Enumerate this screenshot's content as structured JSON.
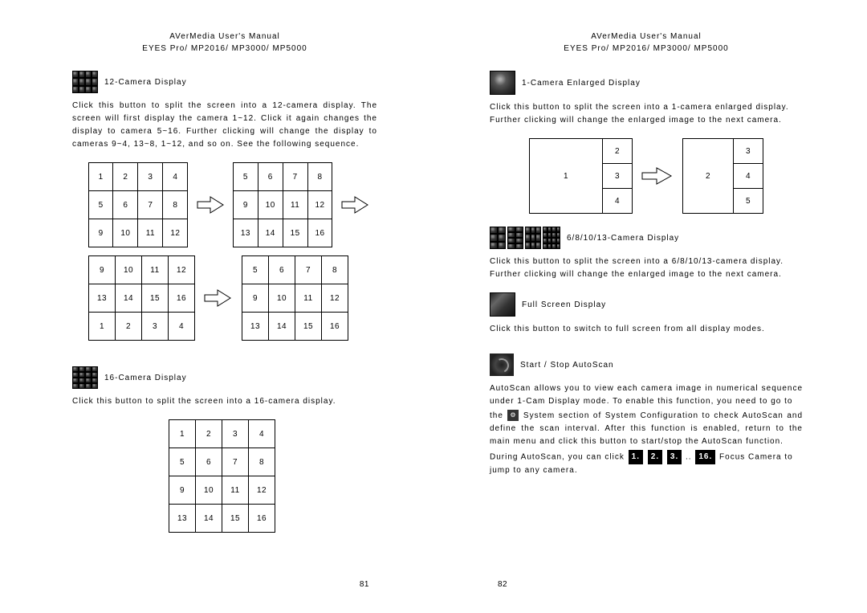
{
  "header": "AVerMedia User's Manual",
  "subheader": "EYES Pro/ MP2016/ MP3000/ MP5000",
  "left": {
    "sec12": {
      "title": "12-Camera Display",
      "para": "Click this button to split the screen into a 12-camera display.  The screen will first display the camera 1~12.  Click it again changes the display to camera 5~16.  Further clicking will change the display to cameras 9~4, 13~8, 1~12, and so on.  See the following sequence."
    },
    "grid1": [
      [
        "1",
        "2",
        "3",
        "4"
      ],
      [
        "5",
        "6",
        "7",
        "8"
      ],
      [
        "9",
        "10",
        "11",
        "12"
      ]
    ],
    "grid2": [
      [
        "5",
        "6",
        "7",
        "8"
      ],
      [
        "9",
        "10",
        "11",
        "12"
      ],
      [
        "13",
        "14",
        "15",
        "16"
      ]
    ],
    "grid3": [
      [
        "9",
        "10",
        "11",
        "12"
      ],
      [
        "13",
        "14",
        "15",
        "16"
      ],
      [
        "1",
        "2",
        "3",
        "4"
      ]
    ],
    "grid4": [
      [
        "5",
        "6",
        "7",
        "8"
      ],
      [
        "9",
        "10",
        "11",
        "12"
      ],
      [
        "13",
        "14",
        "15",
        "16"
      ]
    ],
    "sec16": {
      "title": "16-Camera Display",
      "para": "Click this button to split the screen into a 16-camera display."
    },
    "grid16": [
      [
        "1",
        "2",
        "3",
        "4"
      ],
      [
        "5",
        "6",
        "7",
        "8"
      ],
      [
        "9",
        "10",
        "11",
        "12"
      ],
      [
        "13",
        "14",
        "15",
        "16"
      ]
    ],
    "pagenum": "81"
  },
  "right": {
    "sec1": {
      "title": "1-Camera Enlarged Display",
      "para": "Click this button to split the screen into a 1-camera enlarged display.  Further clicking will change the enlarged image to the next camera."
    },
    "layoutA": {
      "big": "1",
      "side": [
        "2",
        "3",
        "4"
      ]
    },
    "layoutB": {
      "big": "2",
      "side": [
        "3",
        "4",
        "5"
      ]
    },
    "sec6": {
      "title": "6/8/10/13-Camera Display",
      "para": "Click this button to split the screen into a 6/8/10/13-camera display.  Further clicking will change the enlarged image to the next camera."
    },
    "secFull": {
      "title": "Full Screen Display",
      "para": "Click this button to switch to full screen from all display modes."
    },
    "secAuto": {
      "title": "Start / Stop AutoScan",
      "p1": "AutoScan allows you to view each camera image in numerical sequence under 1-Cam Display mode.  To enable this function, you need to go to",
      "p2a": "the",
      "p2b": "System section of System Configuration to check AutoScan and define the scan interval.  After this function is enabled, return to the main menu and click this button to start/stop the AutoScan function.",
      "p3a": "During AutoScan, you can click",
      "btns": [
        "1.",
        "2.",
        "3."
      ],
      "ellipsis": "..",
      "btn16": "16.",
      "p3b": "Focus Camera to jump to any camera."
    },
    "pagenum": "82"
  },
  "chart_data": {
    "type": "table",
    "description": "12-camera display click sequence (3 rows × 4 cols each state) and 16-camera grid",
    "twelve_cam_sequence": [
      [
        [
          1,
          2,
          3,
          4
        ],
        [
          5,
          6,
          7,
          8
        ],
        [
          9,
          10,
          11,
          12
        ]
      ],
      [
        [
          5,
          6,
          7,
          8
        ],
        [
          9,
          10,
          11,
          12
        ],
        [
          13,
          14,
          15,
          16
        ]
      ],
      [
        [
          9,
          10,
          11,
          12
        ],
        [
          13,
          14,
          15,
          16
        ],
        [
          1,
          2,
          3,
          4
        ]
      ],
      [
        [
          5,
          6,
          7,
          8
        ],
        [
          9,
          10,
          11,
          12
        ],
        [
          13,
          14,
          15,
          16
        ]
      ]
    ],
    "sixteen_cam_grid": [
      [
        1,
        2,
        3,
        4
      ],
      [
        5,
        6,
        7,
        8
      ],
      [
        9,
        10,
        11,
        12
      ],
      [
        13,
        14,
        15,
        16
      ]
    ],
    "one_cam_enlarged_sequence": [
      {
        "large": 1,
        "side_column": [
          2,
          3,
          4
        ]
      },
      {
        "large": 2,
        "side_column": [
          3,
          4,
          5
        ]
      }
    ]
  }
}
